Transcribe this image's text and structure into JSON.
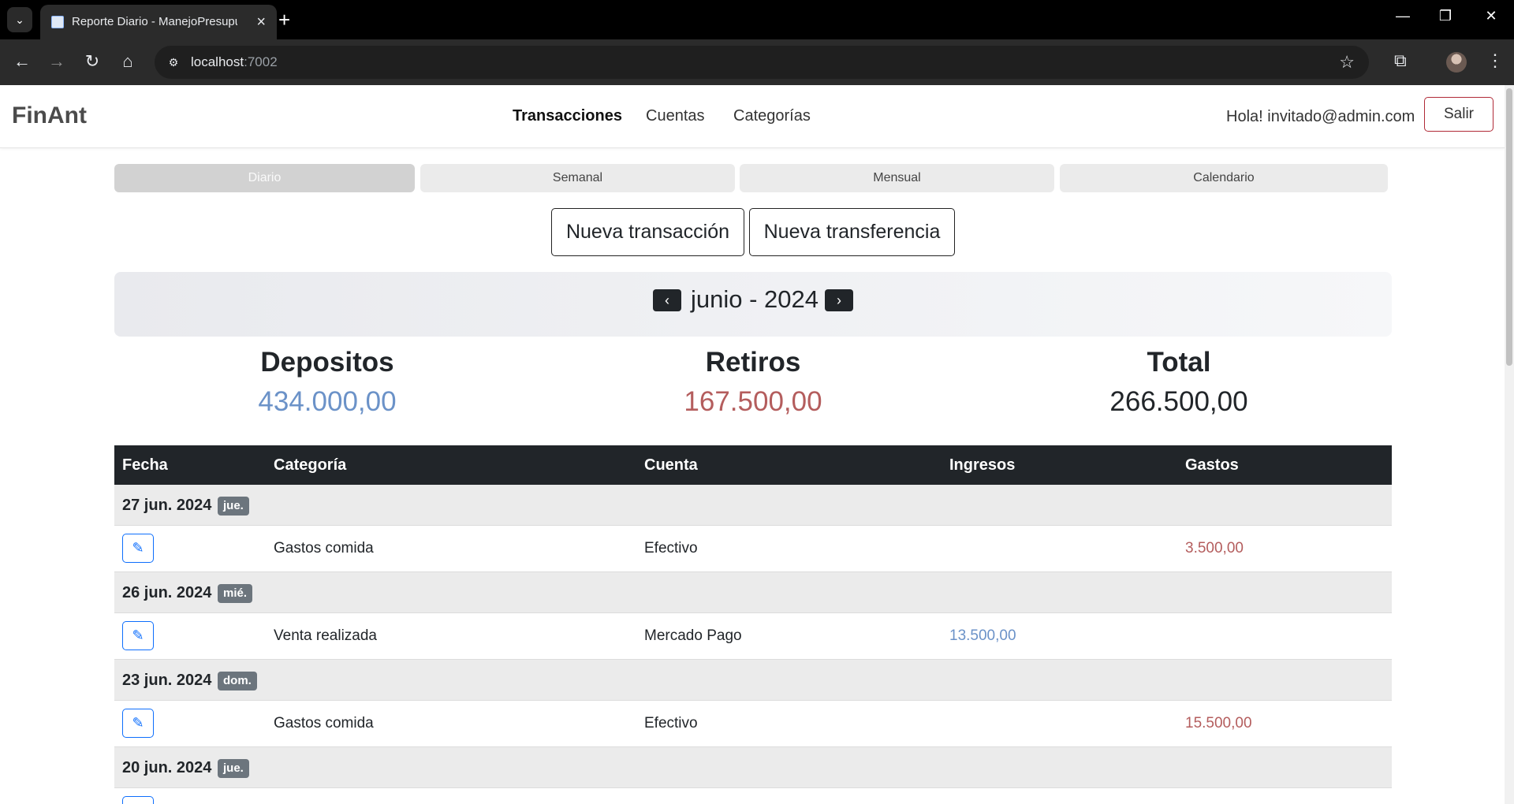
{
  "browser": {
    "tab_title": "Reporte Diario - ManejoPresupuesto",
    "url_host": "localhost",
    "url_port": ":7002",
    "icons": [
      "tab-search-icon",
      "page-icon",
      "close-icon",
      "plus-icon",
      "minimize-icon",
      "restore-icon",
      "close-window-icon",
      "back-icon",
      "forward-icon",
      "reload-icon",
      "home-icon",
      "site-info-icon",
      "bookmark-star-icon",
      "extensions-icon",
      "more-icon"
    ]
  },
  "navbar": {
    "brand": "FinAnt",
    "links": [
      "Transacciones",
      "Cuentas",
      "Categorías"
    ],
    "active_link": "Transacciones",
    "greeting": "Hola! invitado@admin.com",
    "logout": "Salir"
  },
  "period_tabs": [
    "Diario",
    "Semanal",
    "Mensual",
    "Calendario"
  ],
  "active_period": "Diario",
  "actions": {
    "new_transaction": "Nueva transacción",
    "new_transfer": "Nueva transferencia"
  },
  "month_nav": {
    "label": "junio - 2024",
    "prev": "‹",
    "next": "›"
  },
  "summary": {
    "deposits_label": "Depositos",
    "deposits_value": "434.000,00",
    "withdrawals_label": "Retiros",
    "withdrawals_value": "167.500,00",
    "total_label": "Total",
    "total_value": "266.500,00"
  },
  "table": {
    "headers": [
      "Fecha",
      "Categoría",
      "Cuenta",
      "Ingresos",
      "Gastos"
    ],
    "groups": [
      {
        "date": "27 jun. 2024",
        "day": "jue.",
        "rows": [
          {
            "category": "Gastos comida",
            "account": "Efectivo",
            "income": "",
            "expense": "3.500,00"
          }
        ]
      },
      {
        "date": "26 jun. 2024",
        "day": "mié.",
        "rows": [
          {
            "category": "Venta realizada",
            "account": "Mercado Pago",
            "income": "13.500,00",
            "expense": ""
          }
        ]
      },
      {
        "date": "23 jun. 2024",
        "day": "dom.",
        "rows": [
          {
            "category": "Gastos comida",
            "account": "Efectivo",
            "income": "",
            "expense": "15.500,00"
          }
        ]
      },
      {
        "date": "20 jun. 2024",
        "day": "jue.",
        "rows": []
      }
    ]
  },
  "colors": {
    "income": "#6b92c8",
    "expense": "#b45d5d",
    "table_header": "#212529",
    "logout_border": "#b02a37"
  }
}
